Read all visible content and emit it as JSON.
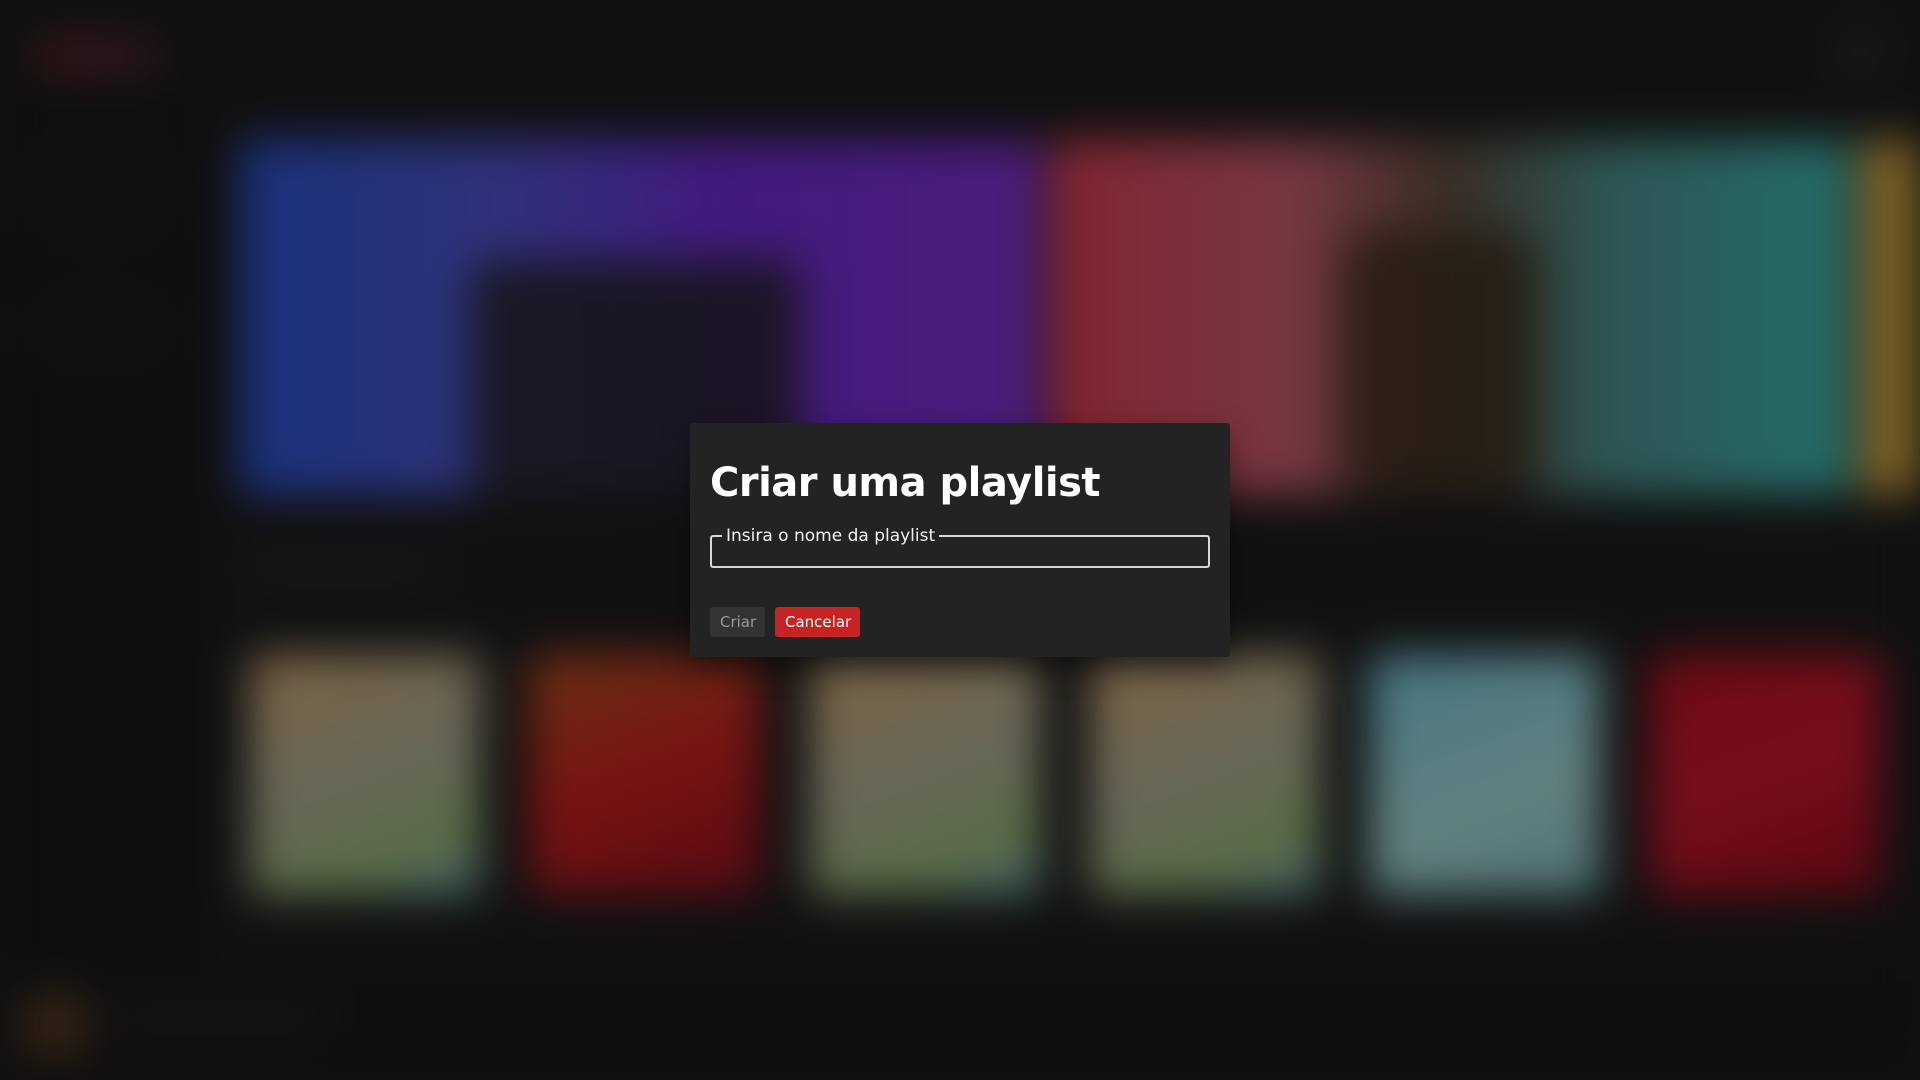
{
  "modal": {
    "title": "Criar uma playlist",
    "name_field": {
      "label": "Insira o nome da playlist",
      "value": ""
    },
    "create_label": "Criar",
    "cancel_label": "Cancelar"
  },
  "colors": {
    "modal_background": "#232323",
    "cancel_button": "#c62424",
    "create_button": "#333333",
    "page_background": "#1c1c1c"
  }
}
